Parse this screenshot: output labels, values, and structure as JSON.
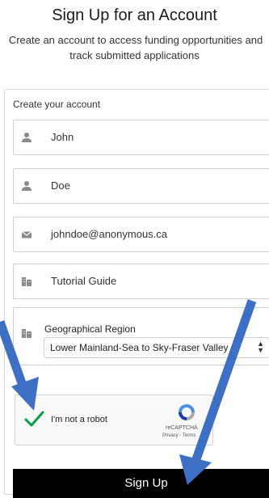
{
  "header": {
    "title": "Sign Up for an Account",
    "subtitle_line1": "Create an account to access funding opportunities and",
    "subtitle_line2": "track submitted applications"
  },
  "form": {
    "heading": "Create your account",
    "first_name": "John",
    "last_name": "Doe",
    "email": "johndoe@anonymous.ca",
    "organization": "Tutorial Guide",
    "region_label": "Geographical Region",
    "region_value": "Lower Mainland-Sea to Sky-Fraser Valley"
  },
  "captcha": {
    "label": "I'm not a robot",
    "brand": "reCAPTCHA",
    "links": "Privacy - Terms",
    "check_color": "#0a9c47"
  },
  "actions": {
    "signup_label": "Sign Up"
  },
  "colors": {
    "annotation_arrow": "#3d6fc5",
    "button_bg": "#000000"
  }
}
